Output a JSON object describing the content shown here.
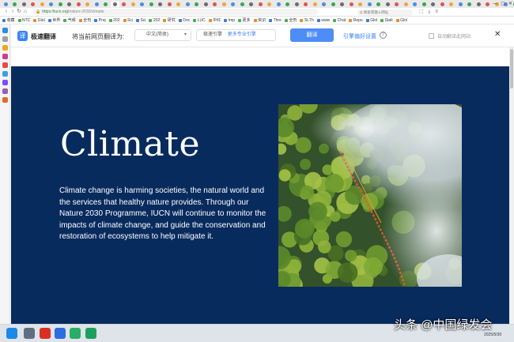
{
  "browser": {
    "tab_count": 58,
    "active_tab_index": 12,
    "window_controls": [
      "—",
      "▢",
      "✕"
    ],
    "nav": {
      "back": "‹",
      "forward": "›",
      "reload": "↻",
      "home": "⌂"
    },
    "url": {
      "scheme": "https://",
      "host": "iucn.org",
      "path": "/nature-2030/climate"
    },
    "search_placeholder": "Q 搜索或输入网址"
  },
  "bookmarks": [
    "收藏",
    "NTC",
    "Glol",
    "世界",
    "气候",
    "全剂",
    "Proj",
    "202",
    "Sci",
    "Sci",
    "202",
    "研究",
    "Doc",
    "LUC",
    "中红",
    "Imp",
    "更多",
    "资识",
    "Thre",
    "全剂",
    "St.Th",
    "www",
    "Chat",
    "Repo",
    "Glol",
    "Stati",
    "Glol"
  ],
  "translate_bar": {
    "logo_glyph": "译",
    "product_name": "极速翻译",
    "prompt": "将当前网页翻译为:",
    "target_language": "中文(简体)",
    "engine": "极速引擎",
    "more_engines": "更多专业引擎",
    "translate_button": "翻译",
    "preferences": "引擎偏好设置",
    "help_glyph": "?",
    "auto_translate": "自动翻译此网站",
    "close_glyph": "✕"
  },
  "hero": {
    "title": "Climate",
    "body": "Climate change is harming societies, the natural world and the services that healthy nature provides. Through our Nature 2030 Programme, IUCN will continue to monitor the impacts of climate change, and guide the conservation and restoration of ecosystems to help mitigate it.",
    "image_subject": "aerial view of forest with wildfire smoke"
  },
  "sidebar": {
    "icons": [
      "home-icon",
      "add-icon",
      "app-icon",
      "mail-icon",
      "app-icon",
      "app-icon",
      "app-icon",
      "app-icon",
      "app-icon"
    ],
    "colors": [
      "#2c8de0",
      "#9aa0a6",
      "#f0a61f",
      "#d23c8a",
      "#e74c3c",
      "#3aa0e8",
      "#7c4dff",
      "#9b59b6",
      "#e06a2d"
    ]
  },
  "taskbar": {
    "apps": [
      "windows-start-icon",
      "file-explorer-icon",
      "wps-icon",
      "browser-icon",
      "wechat-icon",
      "app-icon"
    ],
    "colors": [
      "#1e88e5",
      "#5f6f82",
      "#d93025",
      "#2d6cdf",
      "#2aae67",
      "#1f9f5e"
    ]
  },
  "watermark": "头条 @中国绿发会",
  "clock": "2025/5/30",
  "colors": {
    "hero_bg": "#082b5e",
    "accent": "#4d8df5"
  }
}
